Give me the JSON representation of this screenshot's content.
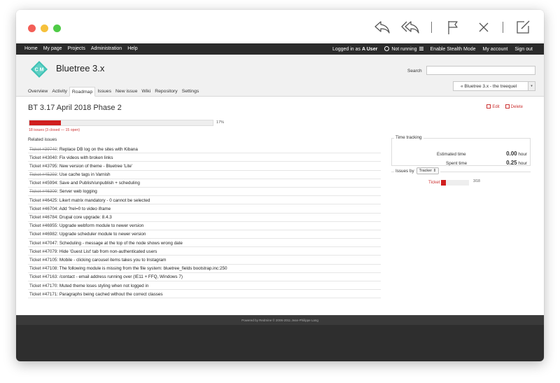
{
  "topmenu": {
    "left": [
      "Home",
      "My page",
      "Projects",
      "Administration",
      "Help"
    ],
    "logged_in_prefix": "Logged in as",
    "user": "A User",
    "status": "Not running",
    "stealth": "Enable Stealth Mode",
    "my_account": "My account",
    "sign_out": "Sign out"
  },
  "header": {
    "logo_text": "C M",
    "project_title": "Bluetree 3.x",
    "search_label": "Search",
    "search_value": "",
    "jump_value": "« Bluetree 3.x - the treequel",
    "tabs": [
      "Overview",
      "Activity",
      "Roadmap",
      "Issues",
      "New issue",
      "Wiki",
      "Repository",
      "Settings"
    ],
    "active_tab": "Roadmap"
  },
  "version": {
    "title": "BT 3.17 April 2018 Phase 2",
    "edit_label": "Edit",
    "delete_label": "Delete",
    "progress_percent": 17,
    "progress_label": "17%",
    "issues_link": "18 issues",
    "issues_summary": "(3 closed — 15 open)",
    "related_title": "Related issues"
  },
  "issues": [
    {
      "id": "Ticket #39740",
      "subject": "Replace DB log on the sites with Kibana",
      "closed": true
    },
    {
      "id": "Ticket #43040",
      "subject": "Fix videos with broken links",
      "closed": false
    },
    {
      "id": "Ticket #43795",
      "subject": "New version of theme - Bluetree 'Lite'",
      "closed": false
    },
    {
      "id": "Ticket #45293",
      "subject": "Use cache tags in Varnish",
      "closed": true
    },
    {
      "id": "Ticket #45994",
      "subject": "Save and Publish/unpublish + scheduling",
      "closed": false
    },
    {
      "id": "Ticket #46309",
      "subject": "Server web logging",
      "closed": true
    },
    {
      "id": "Ticket #46425",
      "subject": "Likert matrix mandatory - 0 cannot be selected",
      "closed": false
    },
    {
      "id": "Ticket #46704",
      "subject": "Add ?rel=0 to video iframe",
      "closed": false
    },
    {
      "id": "Ticket #46784",
      "subject": "Drupal core upgrade: 8.4.3",
      "closed": false
    },
    {
      "id": "Ticket #46955",
      "subject": "Upgrade webform module to newer version",
      "closed": false
    },
    {
      "id": "Ticket #46982",
      "subject": "Upgrade scheduler module to newer version",
      "closed": false
    },
    {
      "id": "Ticket #47047",
      "subject": "Scheduling - message at the top of the node shows wrong date",
      "closed": false
    },
    {
      "id": "Ticket #47079",
      "subject": "Hide 'Guest List' tab from non-authenticated users",
      "closed": false
    },
    {
      "id": "Ticket #47105",
      "subject": "Mobile - clicking carousel items takes you to Instagram",
      "closed": false
    },
    {
      "id": "Ticket #47108",
      "subject": "The following module is missing from the file system: bluetree_fields bootstrap.inc:250",
      "closed": false
    },
    {
      "id": "Ticket #47163",
      "subject": "/contact - email address running over (IE11 + FFQ, Windows 7)",
      "closed": false
    },
    {
      "id": "Ticket #47170",
      "subject": "Muted theme loses styling when not logged in",
      "closed": false
    },
    {
      "id": "Ticket #47171",
      "subject": "Paragraphs being cached without the correct classes",
      "closed": false
    }
  ],
  "time_tracking": {
    "legend": "Time tracking",
    "estimated_label": "Estimated time",
    "estimated_value": "0.00",
    "spent_label": "Spent time",
    "spent_value": "0.25",
    "unit": "hour"
  },
  "issues_by": {
    "legend": "Issues by",
    "select_value": "Tracker",
    "tracker_label": "Ticket",
    "count": "3/18",
    "fraction": 0.1667
  },
  "footer": {
    "text": "Powered by Redmine © 2006-2011 Jean-Philippe Lang"
  },
  "colors": {
    "accent_red": "#d01e1e",
    "topbar": "#2b2b2b",
    "footer": "#2e2e2e"
  }
}
